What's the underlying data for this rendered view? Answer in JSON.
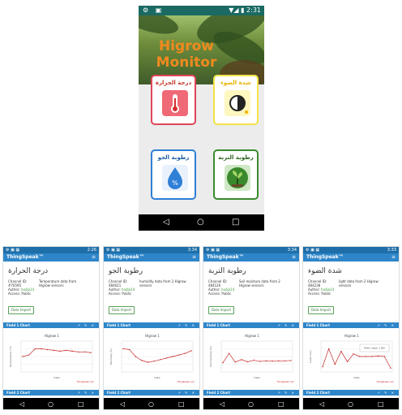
{
  "main": {
    "status": {
      "left": "⚙ ▣",
      "right": "▼◢ ▮ 2:31"
    },
    "title_line1": "Higrow",
    "title_line2": "Monitor",
    "tiles": [
      {
        "label": "درجة الحرارة",
        "icon": "thermometer-icon",
        "color": "#e0465a"
      },
      {
        "label": "شدة الضوء",
        "icon": "light-bulb-icon",
        "color": "#f2e34a"
      },
      {
        "label": "رطوبة الجو",
        "icon": "water-drop-icon",
        "color": "#2f7fd6"
      },
      {
        "label": "رطوبة التربة",
        "icon": "plant-icon",
        "color": "#3a8a2d"
      }
    ],
    "nav": {
      "back": "◁",
      "home": "○",
      "recent": "□"
    }
  },
  "screens": [
    {
      "time": "2:26",
      "title": "درجة الحرارة",
      "channel_label": "Channel ID:",
      "channel_id": "#70595",
      "author_label": "Author:",
      "author": "hodja14",
      "access": "Access: Public",
      "desc": "Temperature data from Higrow sensors",
      "button": "Data Import",
      "field1": "Field 1 Chart",
      "field2": "Field 2 Chart",
      "chart_title": "Higrow 1",
      "ylabel": "Temperature (°C)",
      "xlabel": "Date",
      "footer": "ThingSpeak.com"
    },
    {
      "time": "3:34",
      "title": "رطوبة الجو",
      "channel_label": "Channel ID:",
      "channel_id": "484021",
      "author_label": "Author:",
      "author": "hodja14",
      "access": "Access: Public",
      "desc": "humidity data from 2 Higrow sensors",
      "button": "Data Import",
      "field1": "Field 1 Chart",
      "field2": "Field 2 Chart",
      "chart_title": "Higrow 1",
      "ylabel": "Humidity (%)",
      "xlabel": "Date",
      "footer": "ThingSpeak.com"
    },
    {
      "time": "3:34",
      "title": "رطوبة التربة",
      "channel_label": "Channel ID:",
      "channel_id": "484120",
      "author_label": "Author:",
      "author": "hodja14",
      "access": "Access: Public",
      "desc": "Soil moisture data from 2 Higrow sensors",
      "button": "Data Import",
      "field1": "Field 1 Chart",
      "field2": "Field 2 Chart",
      "chart_title": "Higrow 1",
      "ylabel": "Soil moisture (%)",
      "xlabel": "Date",
      "footer": "ThingSpeak.com"
    },
    {
      "time": "3:33",
      "title": "شدة الضوء",
      "channel_label": "Channel ID:",
      "channel_id": "484238",
      "author_label": "Author:",
      "author": "hodja14",
      "access": "Access: Public",
      "desc": "light data from 2 Higrow sensors",
      "button": "Data Import",
      "field1": "Field 1 Chart",
      "field2": "Field 2 Chart",
      "chart_title": "Higrow 1",
      "ylabel": "Light (lux)",
      "xlabel": "Date",
      "footer": "ThingSpeak.com",
      "tooltip": "Field 1 value: 1 200"
    }
  ],
  "common": {
    "brand": "ThingSpeak™",
    "menu_icon": "menu-icon",
    "nav": {
      "back": "◁",
      "home": "○",
      "recent": "□"
    }
  },
  "colors": {
    "status_main": "#1a6a63",
    "header_small": "#2e86c9",
    "title_orange": "#f08a1e",
    "chart_line": "#c62828"
  },
  "chart_data": [
    {
      "type": "line",
      "title": "Higrow 1",
      "ylabel": "Temperature (°C)",
      "xlabel": "Date",
      "y": [
        20,
        22,
        30,
        30,
        29,
        28,
        27,
        28,
        27,
        26,
        26,
        25
      ],
      "ylim": [
        0,
        40
      ]
    },
    {
      "type": "line",
      "title": "Higrow 1",
      "ylabel": "Humidity (%)",
      "xlabel": "Date",
      "y": [
        60,
        58,
        40,
        30,
        25,
        28,
        32,
        36,
        40,
        44,
        48,
        55
      ],
      "ylim": [
        0,
        80
      ]
    },
    {
      "type": "line",
      "title": "Higrow 1",
      "ylabel": "Soil moisture (%)",
      "xlabel": "Date",
      "y": [
        30,
        60,
        32,
        40,
        33,
        38,
        34,
        36,
        35,
        36,
        36,
        37
      ],
      "ylim": [
        0,
        100
      ]
    },
    {
      "type": "line",
      "title": "Higrow 1",
      "ylabel": "Light (lux)",
      "xlabel": "Date",
      "y": [
        200,
        900,
        300,
        800,
        400,
        700,
        600,
        600,
        600,
        620,
        600,
        150
      ],
      "ylim": [
        0,
        1200
      ]
    }
  ]
}
